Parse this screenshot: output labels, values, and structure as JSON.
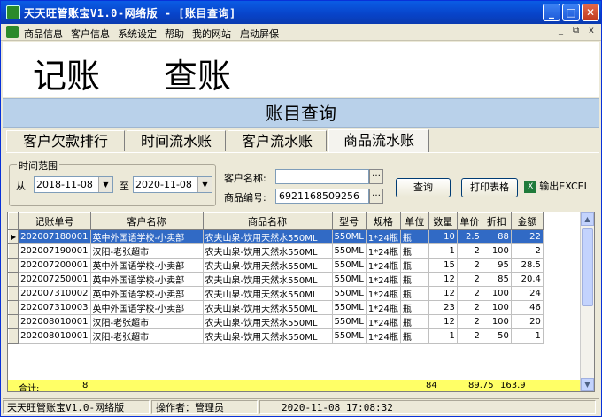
{
  "window": {
    "title": "天天旺管账宝V1.0-网络版 - [账目查询]",
    "min_label": "_",
    "max_label": "□",
    "close_label": "✕"
  },
  "menu": {
    "items": [
      "商品信息",
      "客户信息",
      "系统设定",
      "帮助",
      "我的网站",
      "启动屏保"
    ],
    "right_controls": [
      "_",
      "⧉",
      "x"
    ]
  },
  "header": {
    "left": "记账",
    "right": "查账"
  },
  "banner": {
    "title": "账目查询"
  },
  "tabs": [
    "客户欠款排行",
    "时间流水账",
    "客户流水账",
    "商品流水账"
  ],
  "filters": {
    "group_label": "时间范围",
    "from_label": "从",
    "from_date": "2018-11-08",
    "to_label": "至",
    "to_date": "2020-11-08",
    "customer_label": "客户名称:",
    "customer_value": "",
    "product_label": "商品编号:",
    "product_value": "6921168509256",
    "query_button": "查询",
    "print_button": "打印表格",
    "excel_button": "输出EXCEL"
  },
  "table": {
    "columns": [
      "记账单号",
      "客户名称",
      "商品名称",
      "型号",
      "规格",
      "单位",
      "数量",
      "单价",
      "折扣",
      "金额"
    ],
    "rows": [
      [
        "202007180001",
        "英中外国语学校-小卖部",
        "农夫山泉-饮用天然水550ML",
        "550ML",
        "1*24瓶",
        "瓶",
        "10",
        "2.5",
        "88",
        "22"
      ],
      [
        "202007190001",
        "汉阳-老张超市",
        "农夫山泉-饮用天然水550ML",
        "550ML",
        "1*24瓶",
        "瓶",
        "1",
        "2",
        "100",
        "2"
      ],
      [
        "202007200001",
        "英中外国语学校-小卖部",
        "农夫山泉-饮用天然水550ML",
        "550ML",
        "1*24瓶",
        "瓶",
        "15",
        "2",
        "95",
        "28.5"
      ],
      [
        "202007250001",
        "英中外国语学校-小卖部",
        "农夫山泉-饮用天然水550ML",
        "550ML",
        "1*24瓶",
        "瓶",
        "12",
        "2",
        "85",
        "20.4"
      ],
      [
        "202007310002",
        "英中外国语学校-小卖部",
        "农夫山泉-饮用天然水550ML",
        "550ML",
        "1*24瓶",
        "瓶",
        "12",
        "2",
        "100",
        "24"
      ],
      [
        "202007310003",
        "英中外国语学校-小卖部",
        "农夫山泉-饮用天然水550ML",
        "550ML",
        "1*24瓶",
        "瓶",
        "23",
        "2",
        "100",
        "46"
      ],
      [
        "202008010001",
        "汉阳-老张超市",
        "农夫山泉-饮用天然水550ML",
        "550ML",
        "1*24瓶",
        "瓶",
        "12",
        "2",
        "100",
        "20"
      ],
      [
        "202008010001",
        "汉阳-老张超市",
        "农夫山泉-饮用天然水550ML",
        "550ML",
        "1*24瓶",
        "瓶",
        "1",
        "2",
        "50",
        "1"
      ]
    ],
    "totals": {
      "label": "合计:",
      "count": "8",
      "qty": "84",
      "discount": "89.75",
      "amount": "163.9"
    }
  },
  "status": {
    "app": "天天旺管账宝V1.0-网络版",
    "operator": "操作者：管理员",
    "datetime": "2020-11-08  17:08:32"
  }
}
